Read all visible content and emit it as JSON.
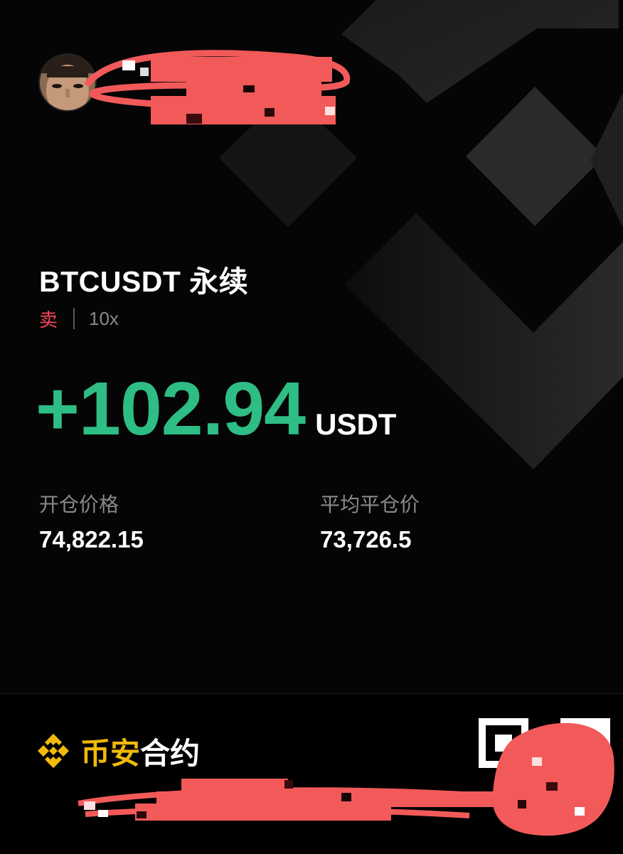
{
  "card": {
    "symbol": "BTCUSDT",
    "contract_type": "永续",
    "side": "卖",
    "leverage": "10x",
    "pnl": "+102.94",
    "pnl_unit": "USDT",
    "entry_price_label": "开仓价格",
    "entry_price": "74,822.15",
    "avg_close_price_label": "平均平仓价",
    "avg_close_price": "73,726.5"
  },
  "footer": {
    "brand_accent": "币安",
    "brand_rest": "合约"
  },
  "colors": {
    "profit": "#2ebd85",
    "sell": "#f6465d",
    "brand": "#f0b90b",
    "background": "#050505"
  }
}
